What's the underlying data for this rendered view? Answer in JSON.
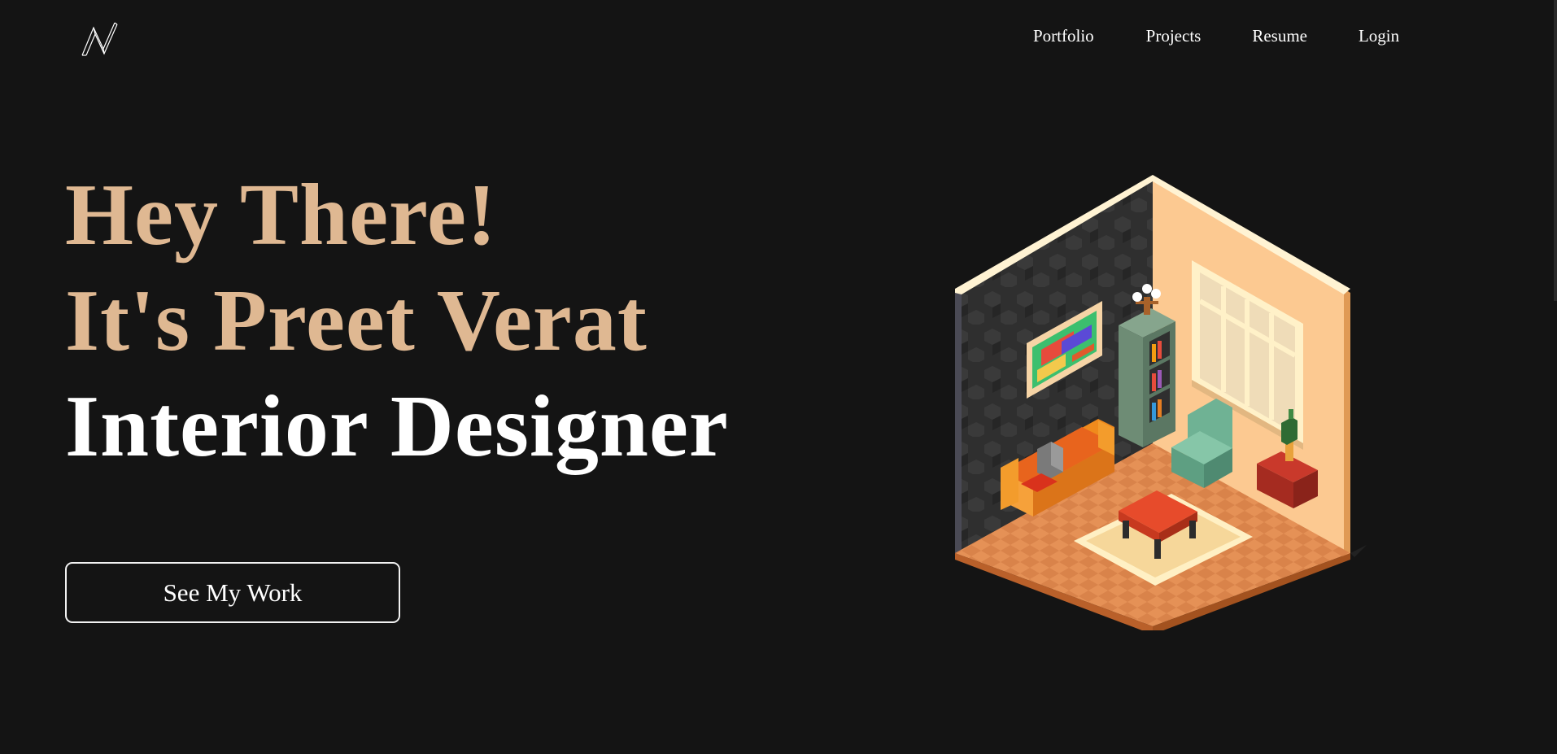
{
  "logo": {
    "icon": "n-monogram-icon"
  },
  "nav": {
    "items": [
      {
        "label": "Portfolio"
      },
      {
        "label": "Projects"
      },
      {
        "label": "Resume"
      },
      {
        "label": "Login"
      }
    ]
  },
  "hero": {
    "line1": "Hey There!",
    "line2": "It's Preet Verat",
    "line3": "Interior Designer",
    "cta_label": "See My Work"
  },
  "colors": {
    "background": "#141414",
    "accent": "#dfb892",
    "text": "#ffffff"
  },
  "illustration": {
    "icon": "isometric-living-room-illustration"
  }
}
